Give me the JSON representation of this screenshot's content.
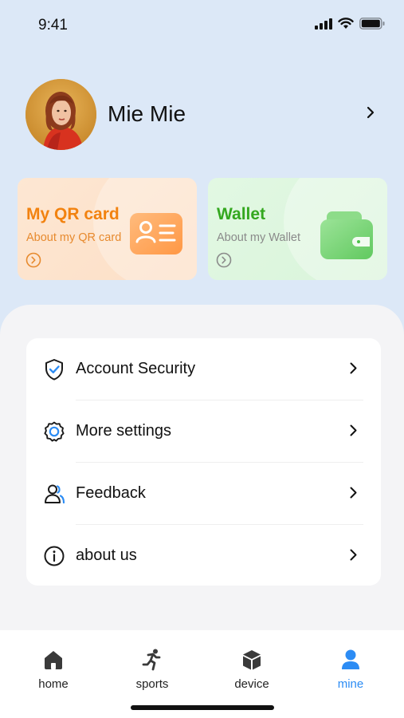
{
  "status_bar": {
    "time": "9:41"
  },
  "profile": {
    "name": "Mie Mie"
  },
  "cards": {
    "qr": {
      "title": "My QR card",
      "subtitle": "About my QR card",
      "accent": "#f2820f"
    },
    "wallet": {
      "title": "Wallet",
      "subtitle": "About my Wallet",
      "accent": "#34a81f"
    }
  },
  "menu": {
    "items": [
      {
        "label": "Account Security",
        "icon": "shield-check-icon"
      },
      {
        "label": "More settings",
        "icon": "gear-icon"
      },
      {
        "label": "Feedback",
        "icon": "people-icon"
      },
      {
        "label": "about us",
        "icon": "info-icon"
      }
    ]
  },
  "tabbar": {
    "items": [
      {
        "label": "home",
        "icon": "home-icon",
        "active": false
      },
      {
        "label": "sports",
        "icon": "runner-icon",
        "active": false
      },
      {
        "label": "device",
        "icon": "cube-icon",
        "active": false
      },
      {
        "label": "mine",
        "icon": "person-icon",
        "active": true
      }
    ],
    "active_color": "#2c8cf4"
  }
}
